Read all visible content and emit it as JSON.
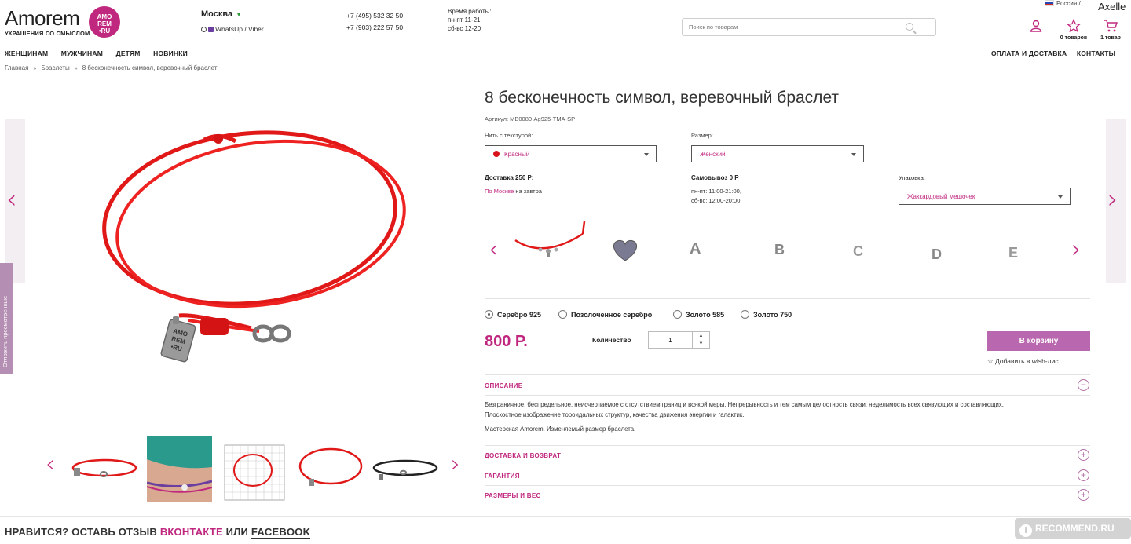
{
  "header": {
    "logo_text": "Amorem",
    "logo_tagline": "УКРАШЕНИЯ СО СМЫСЛОМ",
    "logo_badge": [
      "AMO",
      "REM",
      "•RU"
    ],
    "city": "Москва",
    "messengers": "WhatsUp / Viber",
    "phones": [
      "+7 (495) 532 32 50",
      "+7 (903) 222 57 50"
    ],
    "hours_title": "Время работы:",
    "hours": [
      "пн-пт 11-21",
      "сб-вс 12-20"
    ],
    "search_placeholder": "Поиск по товарам",
    "language": "Россия",
    "lang_sep": "/",
    "username": "Axelle",
    "wishlist_count": "0 товаров",
    "cart_count": "1 товар",
    "brand_color": "#c0287f"
  },
  "nav": {
    "left": [
      "ЖЕНЩИНАМ",
      "МУЖЧИНАМ",
      "ДЕТЯМ",
      "НОВИНКИ"
    ],
    "right": [
      "ОПЛАТА И ДОСТАВКА",
      "КОНТАКТЫ"
    ]
  },
  "breadcrumb": [
    "Главная",
    "Браслеты",
    "8 бесконечность символ, веревочный браслет"
  ],
  "side_tab": "Отложить просмотренные",
  "product": {
    "title": "8 бесконечность символ, веревочный браслет",
    "sku": "Артикул: MB0080-Ag925-TMA-SP",
    "thread_label": "Нить с текстурой:",
    "thread_value": "Красный",
    "size_label": "Размер:",
    "size_value": "Женский",
    "delivery_title": "Доставка 250 Р:",
    "delivery_link": "По Москве",
    "delivery_rest": " на завтра",
    "pickup_title": "Самовывоз 0 Р",
    "pickup_hours": [
      "пн-пт: 11:00-21:00,",
      "сб-вс: 12:00-20:00"
    ],
    "package_label": "Упаковка:",
    "package_value": "Жаккардовый мешочек",
    "metals": [
      "Серебро 925",
      "Позолоченное серебро",
      "Золото 585",
      "Золото 750"
    ],
    "metal_selected": 0,
    "price": "800 Р.",
    "qty_label": "Количество",
    "qty_value": "1",
    "cart_button": "В корзину",
    "wish_link": "Добавить в wish-лист",
    "description_title": "ОПИСАНИЕ",
    "description_lines": [
      "Безграничное, беспредельное, неисчерпаемое с отсутствием границ и всякой меры. Непрерывность и тем самым целостность связи, неделимость всех связующих и составляющих.",
      "Плоскостное изображение тороидальных структур, качества движения энергии и галактик."
    ],
    "description_extra": "Мастерская Amorem. Изменяемый размер браслета.",
    "sections": [
      "ДОСТАВКА И ВОЗВРАТ",
      "ГАРАНТИЯ",
      "РАЗМЕРЫ И ВЕС"
    ],
    "main_tag_text": [
      "AMO",
      "REM",
      "•RU"
    ]
  },
  "footer": {
    "review_prefix": "НРАВИТСЯ? ОСТАВЬ ОТЗЫВ ",
    "vk": "ВКОНТАКТЕ",
    "or": " ИЛИ ",
    "fb": "FACEBOOK"
  },
  "watermark": "RECOMMEND.RU"
}
